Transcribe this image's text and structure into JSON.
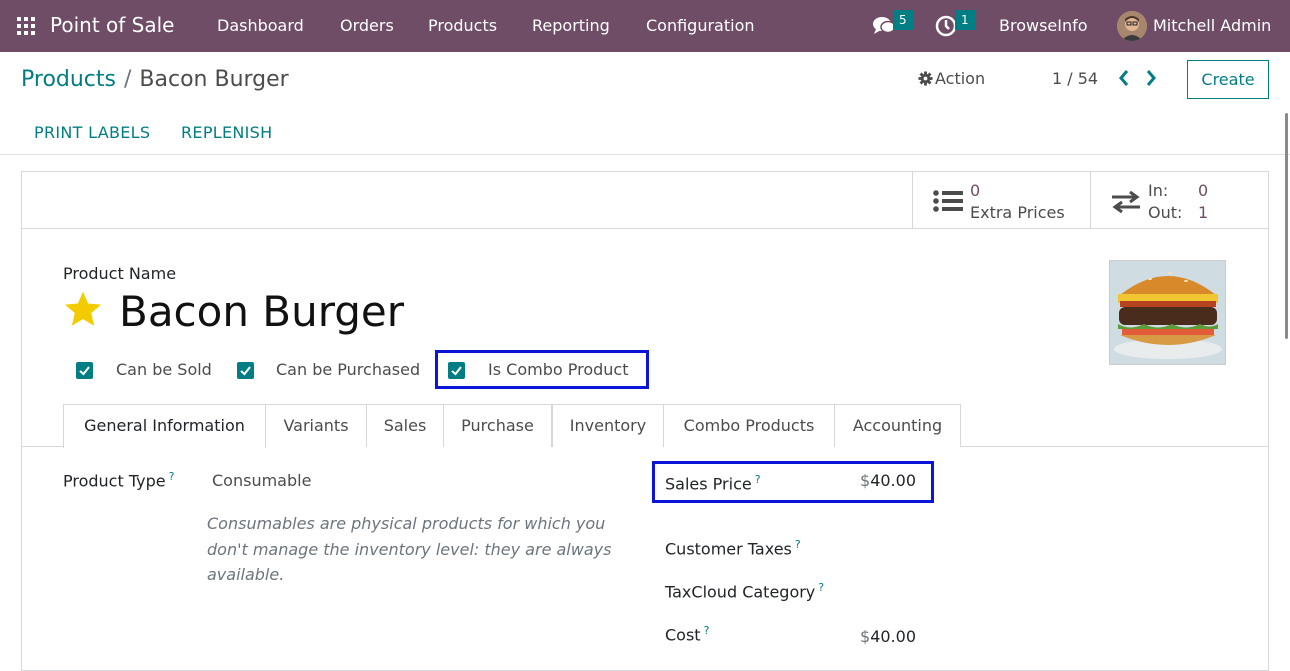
{
  "navbar": {
    "app_name": "Point of Sale",
    "menu": [
      "Dashboard",
      "Orders",
      "Products",
      "Reporting",
      "Configuration"
    ],
    "messages_count": "5",
    "activities_count": "1",
    "company": "BrowseInfo",
    "user": "Mitchell Admin"
  },
  "breadcrumb": {
    "parent": "Products",
    "separator": "/",
    "current": "Bacon Burger"
  },
  "control": {
    "action_label": "Action",
    "pager": "1 / 54",
    "create_label": "Create",
    "buttons": [
      "PRINT LABELS",
      "REPLENISH"
    ]
  },
  "smart_buttons": {
    "extra_prices_count": "0",
    "extra_prices_label": "Extra Prices",
    "in_label": "In:",
    "in_value": "0",
    "out_label": "Out:",
    "out_value": "1"
  },
  "product": {
    "name_label": "Product Name",
    "name": "Bacon Burger",
    "favorite": true,
    "checkboxes": [
      {
        "label": "Can be Sold",
        "checked": true
      },
      {
        "label": "Can be Purchased",
        "checked": true
      },
      {
        "label": "Is Combo Product",
        "checked": true
      }
    ]
  },
  "tabs": [
    "General Information",
    "Variants",
    "Sales",
    "Purchase",
    "Inventory",
    "Combo Products",
    "Accounting"
  ],
  "active_tab": "General Information",
  "general": {
    "product_type_label": "Product Type",
    "product_type_value": "Consumable",
    "product_type_help": "Consumables are physical products for which you don't manage the inventory level: they are always available.",
    "sales_price_label": "Sales Price",
    "sales_price_currency": "$",
    "sales_price_value": "40.00",
    "customer_taxes_label": "Customer Taxes",
    "taxcloud_label": "TaxCloud Category",
    "cost_label": "Cost",
    "cost_currency": "$",
    "cost_value": "40.00",
    "help_mark": "?"
  },
  "colors": {
    "navbar": "#6f4d66",
    "accent": "#017e84",
    "highlight": "#0a15d8",
    "star": "#f3cc00"
  }
}
